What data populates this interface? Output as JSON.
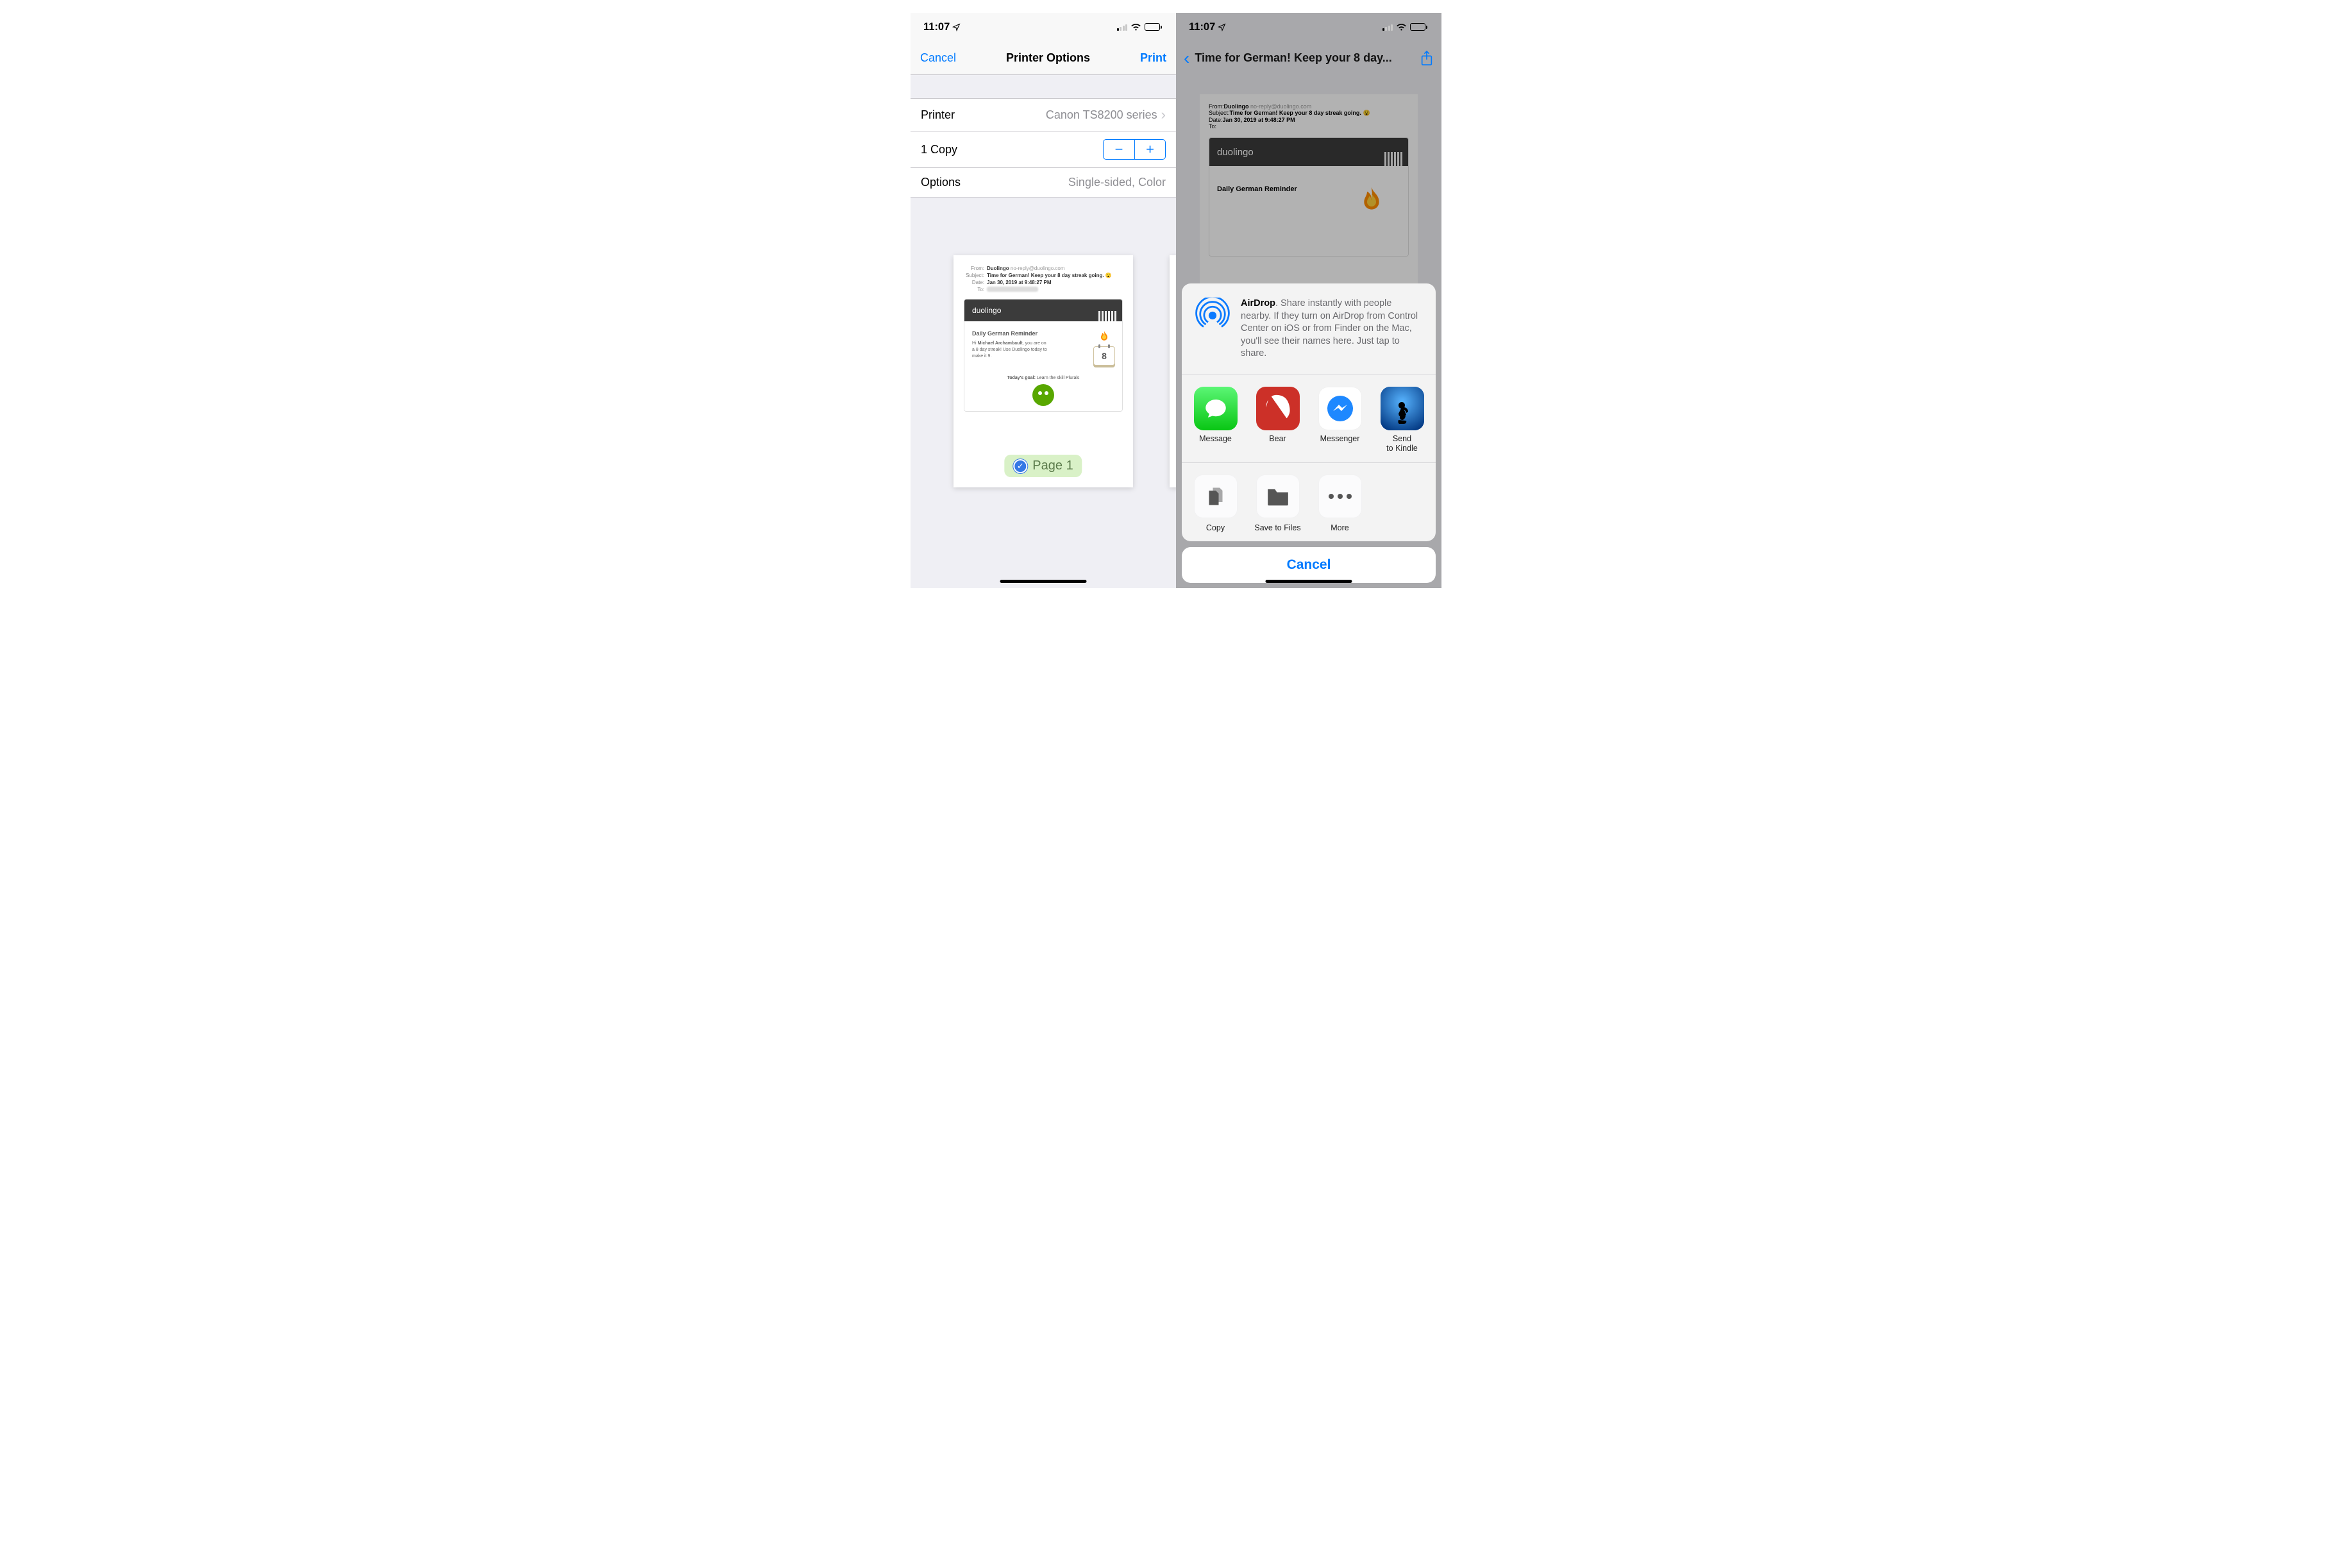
{
  "status": {
    "time": "11:07",
    "location": true
  },
  "left": {
    "nav": {
      "cancel": "Cancel",
      "title": "Printer Options",
      "print": "Print"
    },
    "rows": {
      "printer_label": "Printer",
      "printer_value": "Canon TS8200 series",
      "copies_label": "1 Copy",
      "options_label": "Options",
      "options_value": "Single-sided, Color"
    },
    "page": {
      "from_label": "From:",
      "from_name": "Duolingo",
      "from_email": "no-reply@duolingo.com",
      "subject_label": "Subject:",
      "subject": "Time for German! Keep your 8 day streak going.",
      "date_label": "Date:",
      "date": "Jan 30, 2019 at 9:48:27 PM",
      "to_label": "To:",
      "brand": "duolingo",
      "reminder_title": "Daily German Reminder",
      "reminder_body_1": "Hi ",
      "reminder_body_name": "Michael Archambault",
      "reminder_body_2": ", you are on a 8 day streak! Use Duolingo today to make it 9.",
      "calendar_day": "8",
      "goal_prefix": "Today's goal:",
      "goal_text": " Learn the skill Plurals",
      "badge": "Page 1"
    }
  },
  "right": {
    "title": "Time for German! Keep your 8 day...",
    "airdrop_bold": "AirDrop",
    "airdrop_text": ". Share instantly with people nearby. If they turn on AirDrop from Control Center on iOS or from Finder on the Mac, you'll see their names here. Just tap to share.",
    "apps": {
      "message": "Message",
      "bear": "Bear",
      "messenger": "Messenger",
      "kindle_l1": "Send",
      "kindle_l2": "to Kindle"
    },
    "actions": {
      "copy": "Copy",
      "save": "Save to Files",
      "more": "More"
    },
    "cancel": "Cancel"
  }
}
